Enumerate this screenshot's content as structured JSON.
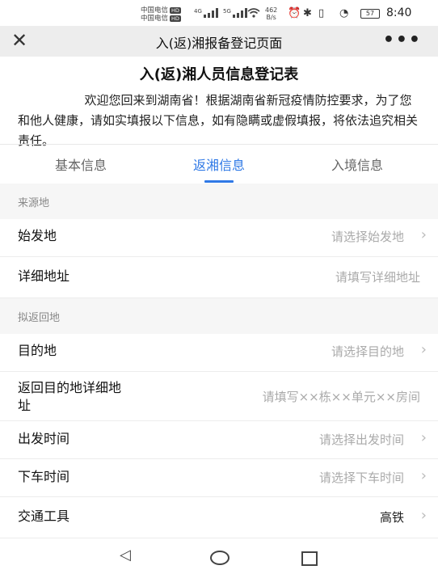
{
  "status_bar": {
    "carrier1": "中国电信",
    "carrier2": "中国电信",
    "hd": "HD",
    "sig1": "4G",
    "sig2": "5G",
    "speed_value": "462",
    "speed_unit": "B/s",
    "battery": "57",
    "time": "8:40"
  },
  "nav": {
    "close": "✕",
    "title": "入(返)湘报备登记页面",
    "more": "•••"
  },
  "form": {
    "title": "入(返)湘人员信息登记表",
    "intro": "欢迎您回来到湖南省！根据湖南省新冠疫情防控要求，为了您和他人健康，请如实填报以下信息，如有隐瞒或虚假填报，将依法追究相关责任。"
  },
  "tabs": [
    "基本信息",
    "返湘信息",
    "入境信息"
  ],
  "sections": {
    "source": "来源地",
    "destination": "拟返回地"
  },
  "fields": {
    "origin": {
      "label": "始发地",
      "placeholder": "请选择始发地"
    },
    "detail_address": {
      "label": "详细地址",
      "placeholder": "请填写详细地址"
    },
    "destination": {
      "label": "目的地",
      "placeholder": "请选择目的地"
    },
    "dest_detail": {
      "label_line1": "返回目的地详细地",
      "label_line2": "址",
      "placeholder": "请填写××栋××单元××房间"
    },
    "depart_time": {
      "label": "出发时间",
      "placeholder": "请选择出发时间"
    },
    "arrive_time": {
      "label": "下车时间",
      "placeholder": "请选择下车时间"
    },
    "transport": {
      "label": "交通工具",
      "value": "高铁"
    }
  },
  "colors": {
    "accent": "#2f79e6",
    "nav_bg": "#ededed",
    "section_bg": "#f6f6f6"
  }
}
